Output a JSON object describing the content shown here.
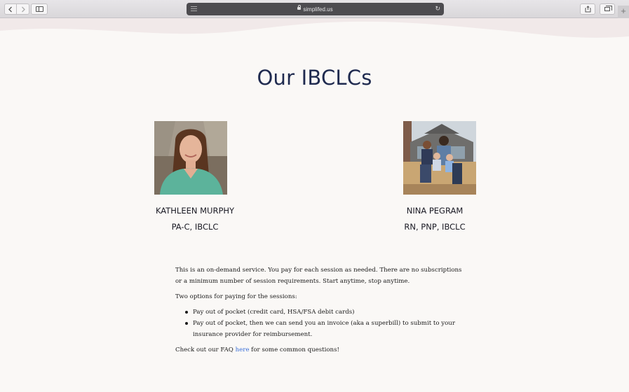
{
  "browser": {
    "url": "simplifed.us",
    "new_tab": "+"
  },
  "page": {
    "title": "Our IBCLCs"
  },
  "consultants": [
    {
      "name": "KATHLEEN MURPHY",
      "credentials": "PA-C, IBCLC"
    },
    {
      "name": "NINA PEGRAM",
      "credentials": "RN, PNP, IBCLC"
    }
  ],
  "info": {
    "intro": "This is an on-demand service.  You pay for each session as needed.  There are no subscriptions or a minimum number of session requirements.  Start anytime, stop anytime.",
    "options_heading": "Two options for paying for the sessions:",
    "options": [
      "Pay out of pocket (credit card, HSA/FSA debit cards)",
      "Pay out of pocket, then we can send you an invoice (aka a superbill) to submit to your insurance provider for reimbursement."
    ],
    "faq_prefix": "Check out our FAQ ",
    "faq_link": "here",
    "faq_suffix": " for some common questions!"
  },
  "colors": {
    "title": "#1f2a4f",
    "link": "#3a6fd8",
    "background": "#faf8f6",
    "wave": "#f1e9e9"
  }
}
